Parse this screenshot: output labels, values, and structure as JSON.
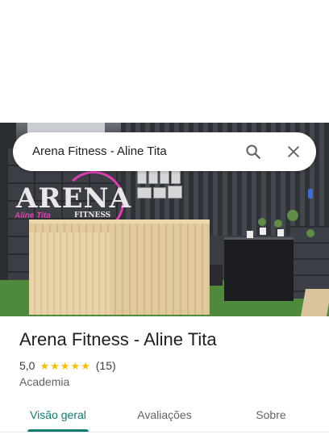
{
  "search": {
    "query": "Arena Fitness - Aline Tita",
    "search_icon": "search-icon",
    "close_icon": "close-icon"
  },
  "photo": {
    "logo_text": "ARENA",
    "logo_subtext": "FITNESS",
    "logo_script": "Aline Tita"
  },
  "place": {
    "name": "Arena Fitness - Aline Tita",
    "rating": "5,0",
    "stars": 5,
    "review_count": "(15)",
    "category": "Academia"
  },
  "tabs": [
    {
      "label": "Visão geral",
      "active": true
    },
    {
      "label": "Avaliações",
      "active": false
    },
    {
      "label": "Sobre",
      "active": false
    }
  ],
  "colors": {
    "accent": "#0b7d75",
    "star": "#fbbc04",
    "text_primary": "#202124",
    "text_secondary": "#5f6368"
  }
}
